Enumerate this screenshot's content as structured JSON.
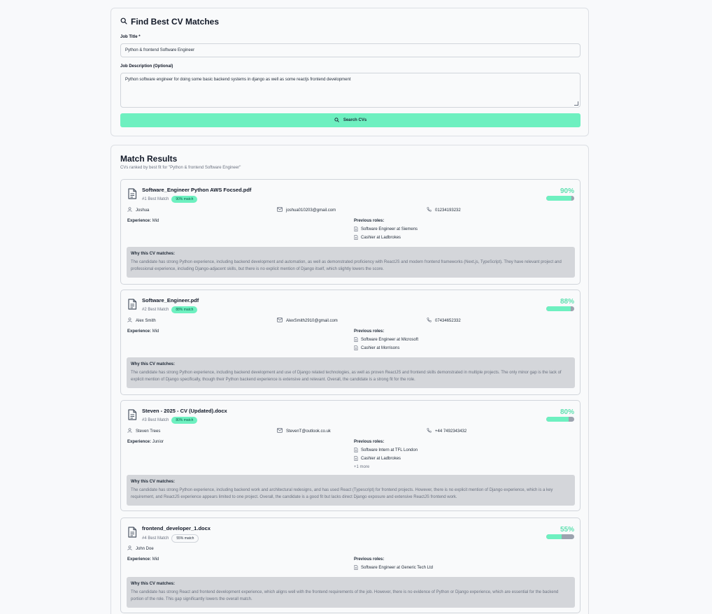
{
  "search": {
    "title": "Find Best CV Matches",
    "job_title_label": "Job Title *",
    "job_title_value": "Python & frontend Software Engineer",
    "job_desc_label": "Job Description (Optional)",
    "job_desc_value": "Python software engineer for doing some basic backend systems in django as well as some reactjs frontend development",
    "button_label": "Search CVs"
  },
  "results": {
    "title": "Match Results",
    "subtitle": "CVs ranked by best fit for \"Python & frontend Software Engineer\"",
    "why_label": "Why this CV matches:",
    "experience_label": "Experience:",
    "previous_roles_label": "Previous roles:",
    "cards": [
      {
        "file_name": "Software_Engineer Python AWS Focsed.pdf",
        "rank": "#1 Best Match",
        "badge": "90% match",
        "percent_label": "90%",
        "match_fraction": 0.9,
        "name": "Joshua",
        "email": "joshua010203@gmail.com",
        "phone": "01234193232",
        "experience": "Mid",
        "roles": [
          "Software Engineer at Siemens",
          "Cashier at Ladbrokes"
        ],
        "more": "",
        "why": "The candidate has strong Python experience, including backend development and automation, as well as demonstrated proficiency with ReactJS and modern frontend frameworks (Next.js, TypeScript). They have relevant project and professional experience, including Django-adjacent skills, but there is no explicit mention of Django itself, which slightly lowers the score."
      },
      {
        "file_name": "Software_Engineer.pdf",
        "rank": "#2 Best Match",
        "badge": "88% match",
        "percent_label": "88%",
        "match_fraction": 0.88,
        "name": "Alex Smith",
        "email": "AlexSmith2910@gmail.com",
        "phone": "07434652332",
        "experience": "Mid",
        "roles": [
          "Software Engineer at Microsoft",
          "Cashier at Morrisons"
        ],
        "more": "",
        "why": "The candidate has strong Python experience, including backend development and use of Django related technologies, as well as proven ReactJS and frontend skills demonstrated in multiple projects. The only minor gap is the lack of explicit mention of Django specifically, though their Python backend experience is extensive and relevant. Overall, the candidate is a strong fit for the role."
      },
      {
        "file_name": "Steven - 2025 - CV (Updated).docx",
        "rank": "#3 Best Match",
        "badge": "80% match",
        "percent_label": "80%",
        "match_fraction": 0.8,
        "name": "Steven Trees",
        "email": "StevenT@outlook.co.uk",
        "phone": "+44 7492343432",
        "experience": "Junior",
        "roles": [
          "Software Intern at TFL London",
          "Cashier at Ladbrokes"
        ],
        "more": "+1 more",
        "why": "The candidate has strong Python experience, including backend work and architectural redesigns, and has used React (Typescript) for frontend projects. However, there is no explicit mention of Django experience, which is a key requirement, and ReactJS experience appears limited to one project. Overall, the candidate is a good fit but lacks direct Django exposure and extensive ReactJS frontend work."
      },
      {
        "file_name": "frontend_developer_1.docx",
        "rank": "#4 Best Match",
        "badge": "55% match",
        "percent_label": "55%",
        "match_fraction": 0.55,
        "name": "John Doe",
        "email": "",
        "phone": "",
        "experience": "Mid",
        "roles": [
          "Software Engineer at Generic Tech Ltd"
        ],
        "more": "",
        "why": "The candidate has strong React and frontend development experience, which aligns well with the frontend requirements of the job. However, there is no evidence of Python or Django experience, which are essential for the backend portion of the role. This gap significantly lowers the overall match."
      }
    ]
  }
}
